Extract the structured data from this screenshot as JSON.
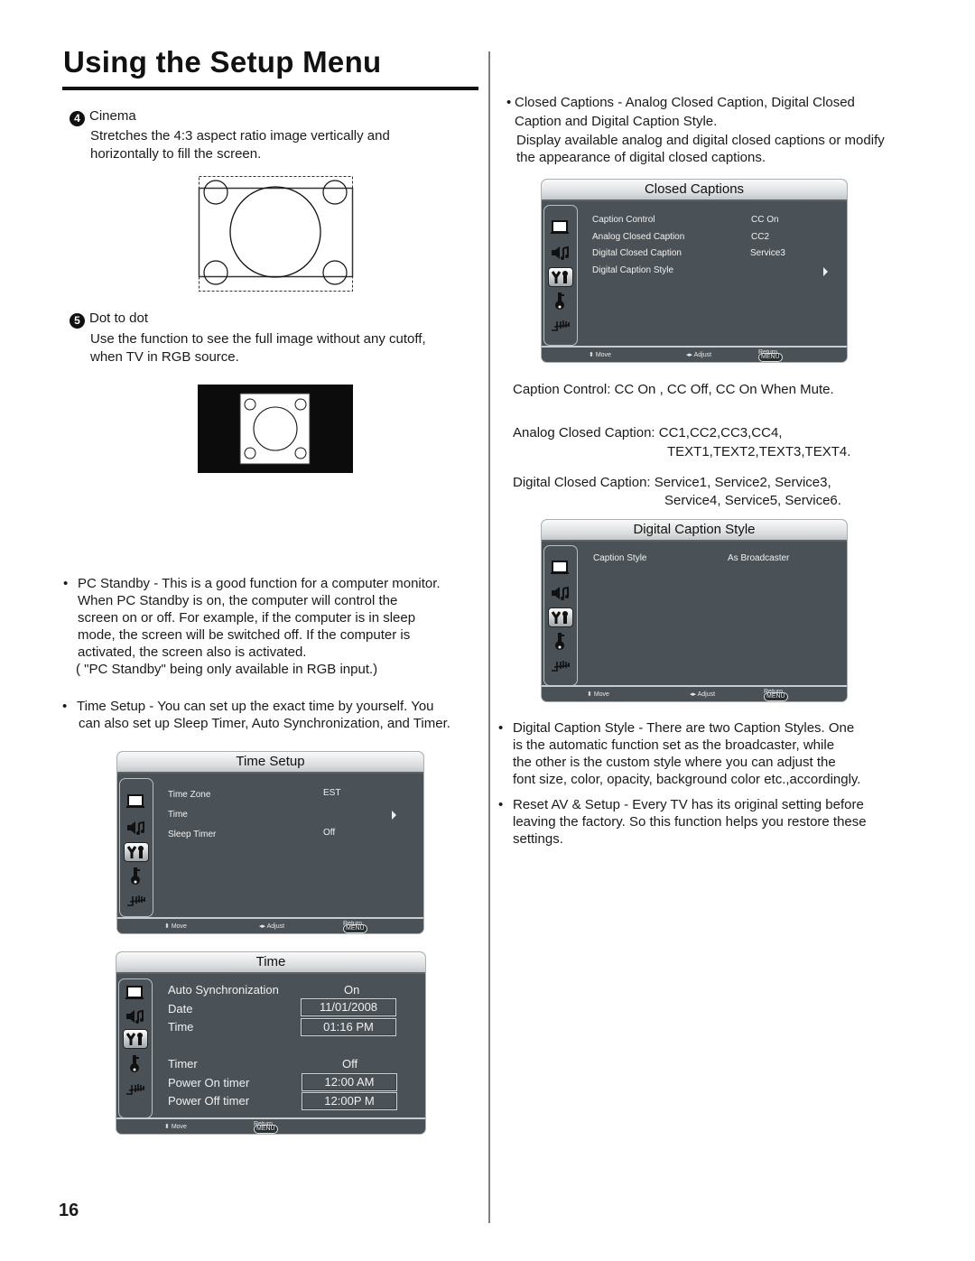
{
  "page": {
    "title": "Using the Setup Menu",
    "page_number": "16"
  },
  "left": {
    "cinema": {
      "number": "4",
      "heading": "Cinema",
      "desc1": "Stretches the 4:3 aspect ratio image vertically and",
      "desc2": "horizontally to fill the screen."
    },
    "dot": {
      "number": "5",
      "heading": "Dot to dot",
      "desc1": "Use the function to see the full image without any cutoff,",
      "desc2": "when TV in RGB source."
    },
    "pc_standby": {
      "lines": [
        "PC Standby - This is a good function for a computer monitor.",
        "When PC Standby is on, the computer will control the",
        "screen on or off. For example, if the computer is in sleep",
        "mode, the screen will be switched off. If the computer is",
        "activated, the screen also is activated.",
        "( \"PC Standby\" being only available in RGB input.)"
      ]
    },
    "time_setup": {
      "lines": [
        "Time Setup - You can set up the exact time by yourself. You",
        "can also set up Sleep Timer, Auto Synchronization, and Timer."
      ]
    }
  },
  "menus": {
    "time_setup": {
      "title": "Time Setup",
      "items": [
        {
          "label": "Time Zone",
          "value": "EST"
        },
        {
          "label": "Time",
          "value": ""
        },
        {
          "label": "Sleep Timer",
          "value": "Off"
        }
      ],
      "footer": {
        "move": "Move",
        "adjust": "Adjust",
        "menu": "MENU",
        "return": "Return"
      }
    },
    "time": {
      "title": "Time",
      "items": [
        {
          "label": "Auto  Synchronization",
          "value": "On"
        },
        {
          "label": "Date",
          "value": "11/01/2008"
        },
        {
          "label": "Time",
          "value": "01:16  PM"
        },
        {
          "label": "Timer",
          "value": "Off"
        },
        {
          "label": "Power On timer",
          "value": "12:00  AM"
        },
        {
          "label": "Power Off timer",
          "value": "12:00P M"
        }
      ],
      "footer": {
        "move": "Move",
        "menu": "MENU",
        "return": "Return"
      }
    },
    "closed_captions": {
      "title": "Closed Captions",
      "items": [
        {
          "label": "Caption Control",
          "value": "CC On"
        },
        {
          "label": "Analog Closed Caption",
          "value": "CC2"
        },
        {
          "label": "Digital Closed Caption",
          "value": "Service3"
        },
        {
          "label": "Digital Caption Style",
          "value": ""
        }
      ],
      "footer": {
        "move": "Move",
        "adjust": "Adjust",
        "menu": "MENU",
        "return": "Return"
      }
    },
    "digital_caption_style": {
      "title": "Digital Caption Style",
      "items": [
        {
          "label": "Caption Style",
          "value": "As Broadcaster"
        }
      ],
      "footer": {
        "move": "Move",
        "adjust": "Adjust",
        "menu": "MENU",
        "return": "Return"
      }
    }
  },
  "right": {
    "closed_captions": {
      "line1": "Closed Captions - Analog Closed Caption, Digital Closed",
      "line2": "Caption and Digital Caption Style.",
      "line3": "Display available analog and digital closed captions or modify",
      "line4": "the appearance of digital closed captions."
    },
    "caption_control": "Caption Control:  CC On , CC Off, CC On When Mute.",
    "analog_cc": {
      "line1": "Analog Closed Caption: CC1,CC2,CC3,CC4,",
      "line2": "TEXT1,TEXT2,TEXT3,TEXT4."
    },
    "digital_cc": {
      "line1": "Digital Closed Caption: Service1, Service2, Service3,",
      "line2": "Service4, Service5, Service6."
    },
    "digital_caption_style": {
      "lines": [
        "Digital Caption Style - There are two Caption Styles. One",
        "is  the automatic function set as the broadcaster, while",
        "the other is the custom style where you can adjust the",
        "font size, color, opacity, background color etc.,accordingly."
      ]
    },
    "reset": {
      "lines": [
        "Reset AV & Setup - Every TV has its original setting before",
        "leaving the factory. So this function helps you restore these",
        "settings."
      ]
    }
  },
  "icons": {
    "sidebar": [
      "picture-icon",
      "audio-icon",
      "setup-icon",
      "lock-icon",
      "channel-icon"
    ]
  }
}
